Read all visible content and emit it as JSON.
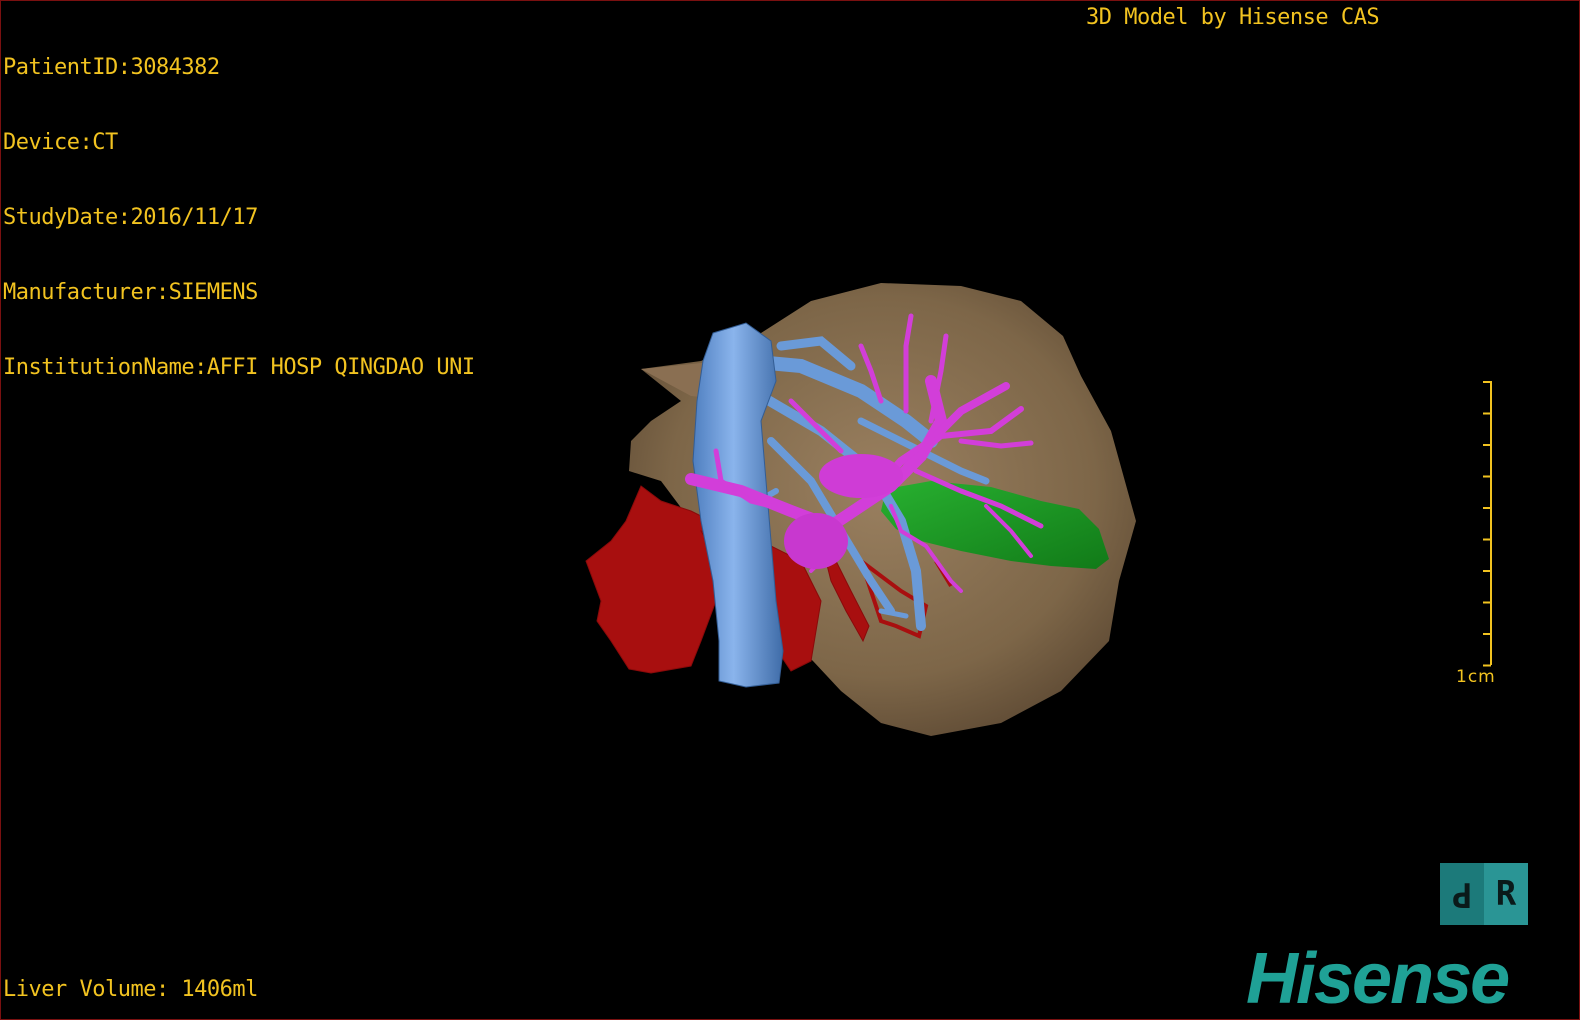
{
  "patient_info": {
    "patient_id": "PatientID:3084382",
    "device": "Device:CT",
    "study_date": "StudyDate:2016/11/17",
    "manufacturer": "Manufacturer:SIEMENS",
    "institution": "InstitutionName:AFFI HOSP QINGDAO UNI"
  },
  "header": {
    "brand_line": "3D Model by Hisense CAS"
  },
  "footer": {
    "liver_volume": "Liver Volume: 1406ml"
  },
  "scale": {
    "label": "1cm"
  },
  "orientation": {
    "face_a": "P",
    "face_b": "R"
  },
  "logo": {
    "text": "Hisense"
  },
  "model_parts": [
    {
      "name": "liver",
      "color": "#8b7355"
    },
    {
      "name": "hepatic-veins",
      "color": "#6a9ad8"
    },
    {
      "name": "portal-vein",
      "color": "#d040d8"
    },
    {
      "name": "hepatic-artery",
      "color": "#b01010"
    },
    {
      "name": "tumor-lesion",
      "color": "#18a020"
    }
  ],
  "colors": {
    "overlay_text": "#f2c320",
    "brand": "#1fa196",
    "frame": "#7a1010"
  }
}
